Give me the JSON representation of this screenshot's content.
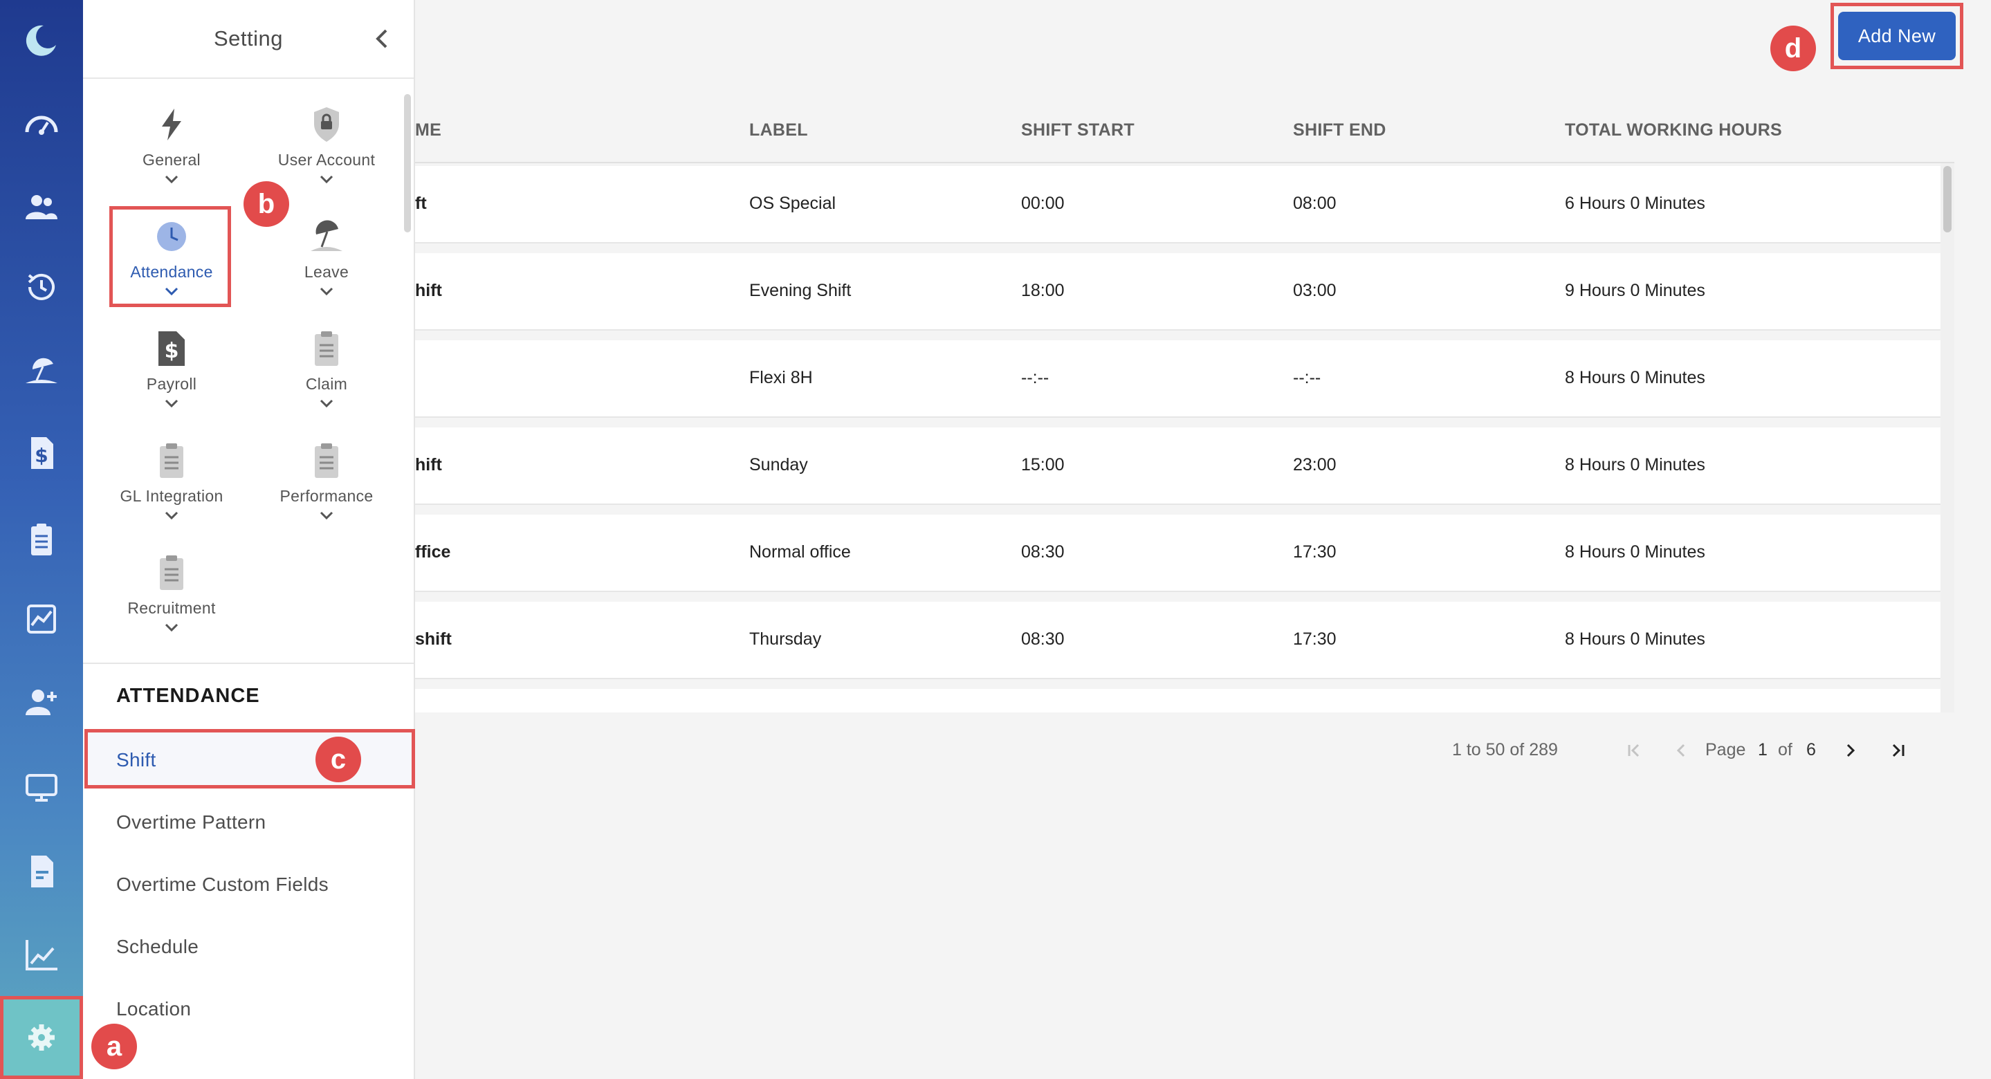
{
  "setting_panel": {
    "title": "Setting",
    "modules": [
      {
        "label": "General",
        "icon": "lightning-icon"
      },
      {
        "label": "User Account",
        "icon": "shield-lock-icon"
      },
      {
        "label": "Attendance",
        "icon": "clock-icon"
      },
      {
        "label": "Leave",
        "icon": "beach-umbrella-icon"
      },
      {
        "label": "Payroll",
        "icon": "dollar-document-icon"
      },
      {
        "label": "Claim",
        "icon": "clipboard-icon"
      },
      {
        "label": "GL Integration",
        "icon": "clipboard-icon"
      },
      {
        "label": "Performance",
        "icon": "clipboard-icon"
      },
      {
        "label": "Recruitment",
        "icon": "clipboard-icon"
      }
    ],
    "section_title": "ATTENDANCE",
    "menu": [
      "Shift",
      "Overtime Pattern",
      "Overtime Custom Fields",
      "Schedule",
      "Location"
    ],
    "active_menu": "Shift"
  },
  "annotations": {
    "a": "a",
    "b": "b",
    "c": "c",
    "d": "d"
  },
  "toolbar": {
    "add_label": "Add New"
  },
  "table": {
    "headers": [
      "ME",
      "LABEL",
      "SHIFT START",
      "SHIFT END",
      "TOTAL WORKING HOURS"
    ],
    "rows": [
      {
        "name": "ft",
        "label": "OS Special",
        "start": "00:00",
        "end": "08:00",
        "hours": "6 Hours 0 Minutes"
      },
      {
        "name": "hift",
        "label": "Evening Shift",
        "start": "18:00",
        "end": "03:00",
        "hours": "9 Hours 0 Minutes"
      },
      {
        "name": "",
        "label": "Flexi 8H",
        "start": "--:--",
        "end": "--:--",
        "hours": "8 Hours 0 Minutes"
      },
      {
        "name": "hift",
        "label": "Sunday",
        "start": "15:00",
        "end": "23:00",
        "hours": "8 Hours 0 Minutes"
      },
      {
        "name": "ffice",
        "label": "Normal office",
        "start": "08:30",
        "end": "17:30",
        "hours": "8 Hours 0 Minutes"
      },
      {
        "name": "shift",
        "label": "Thursday",
        "start": "08:30",
        "end": "17:30",
        "hours": "8 Hours 0 Minutes"
      }
    ]
  },
  "pagination": {
    "range": "1 to 50 of 289",
    "page_label": "Page",
    "current": "1",
    "of_label": "of",
    "total": "6"
  },
  "colors": {
    "accent": "#2f62c0",
    "highlight": "#e25555",
    "rail_top": "#1f3a8f",
    "rail_bottom": "#5ea9c0"
  }
}
